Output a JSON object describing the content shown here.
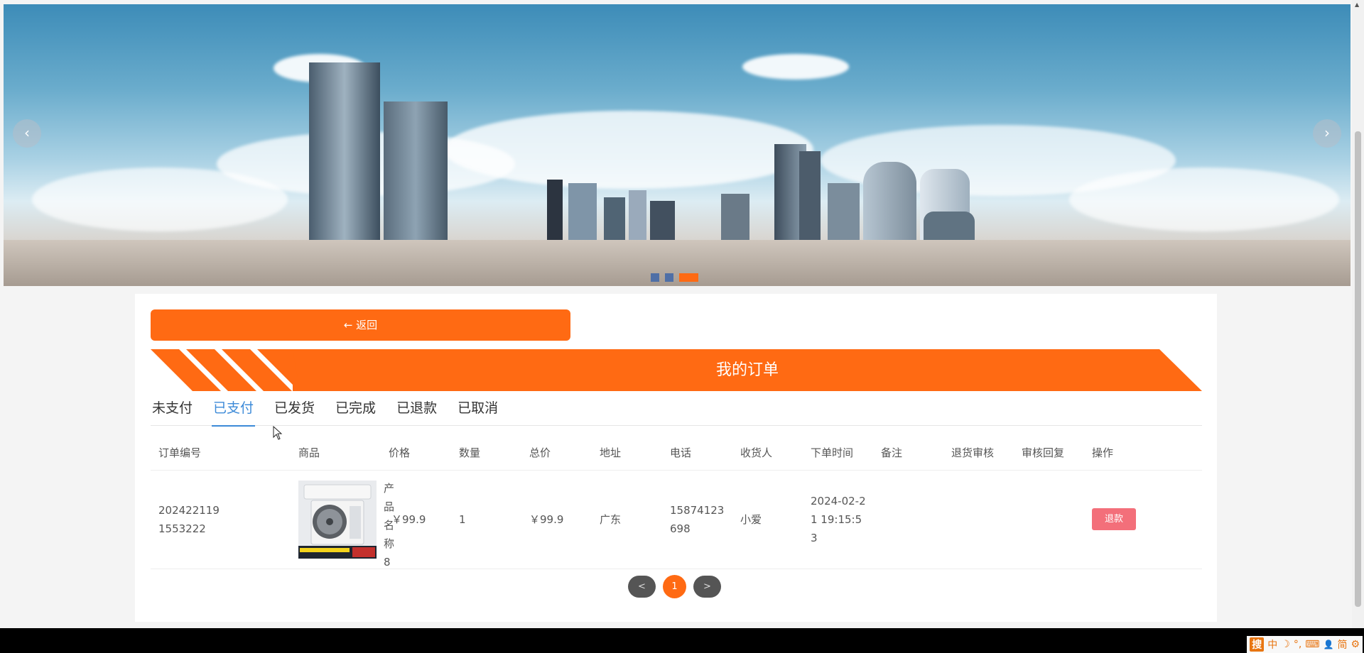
{
  "carousel": {
    "prev_icon": "‹",
    "next_icon": "›",
    "slide_count": 3,
    "active_slide": 3
  },
  "back_button": {
    "label": "← 返回"
  },
  "page_title": "我的订单",
  "tabs": [
    {
      "label": "未支付",
      "active": false
    },
    {
      "label": "已支付",
      "active": true
    },
    {
      "label": "已发货",
      "active": false
    },
    {
      "label": "已完成",
      "active": false
    },
    {
      "label": "已退款",
      "active": false
    },
    {
      "label": "已取消",
      "active": false
    }
  ],
  "table": {
    "headers": [
      "订单编号",
      "商品",
      "价格",
      "数量",
      "总价",
      "地址",
      "电话",
      "收货人",
      "下单时间",
      "备注",
      "退货审核",
      "审核回复",
      "操作"
    ],
    "rows": [
      {
        "order_no": "2024221191553222",
        "product_name": "产品名称8",
        "price": "￥99.9",
        "quantity": "1",
        "total": "￥99.9",
        "address": "广东",
        "phone": "15874123698",
        "receiver": "小爱",
        "order_time": "2024-02-21 19:15:53",
        "remark": "",
        "return_review": "",
        "review_reply": "",
        "action_label": "退款"
      }
    ]
  },
  "pager": {
    "prev": "<",
    "current": "1",
    "next": ">"
  },
  "colors": {
    "accent": "#ff6a13",
    "tab_active": "#3c8ad8",
    "refund": "#f36f7a"
  },
  "ime": {
    "icons": [
      "ime-logo",
      "chinese-mode-icon",
      "moon-icon",
      "punctuation-icon",
      "keyboard-icon",
      "user-icon",
      "simplified-icon",
      "settings-icon"
    ],
    "labels": [
      "搜",
      "中",
      "☽",
      "°,",
      "⌨",
      "👤",
      "简",
      "⚙"
    ]
  }
}
